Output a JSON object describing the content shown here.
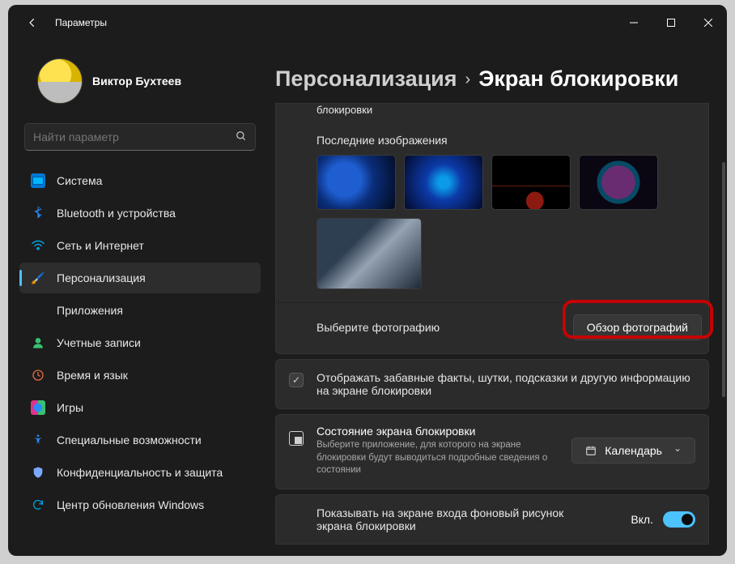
{
  "titlebar": {
    "title": "Параметры"
  },
  "profile": {
    "name": "Виктор Бухтеев",
    "subtitle": ""
  },
  "search": {
    "placeholder": "Найти параметр"
  },
  "sidebar": {
    "items": [
      {
        "label": "Система"
      },
      {
        "label": "Bluetooth и устройства"
      },
      {
        "label": "Сеть и Интернет"
      },
      {
        "label": "Персонализация"
      },
      {
        "label": "Приложения"
      },
      {
        "label": "Учетные записи"
      },
      {
        "label": "Время и язык"
      },
      {
        "label": "Игры"
      },
      {
        "label": "Специальные возможности"
      },
      {
        "label": "Конфиденциальность и защита"
      },
      {
        "label": "Центр обновления Windows"
      }
    ]
  },
  "breadcrumb": {
    "parent": "Персонализация",
    "current": "Экран блокировки"
  },
  "lockscreen": {
    "cutoff_label": "блокировки",
    "recent_label": "Последние изображения",
    "choose_label": "Выберите фотографию",
    "browse_button": "Обзор фотографий",
    "fun_facts": "Отображать забавные факты, шутки, подсказки и другую информацию на экране блокировки",
    "status": {
      "title": "Состояние экрана блокировки",
      "sub": "Выберите приложение, для которого на экране блокировки будут выводиться подробные сведения о состоянии",
      "app": "Календарь"
    },
    "toggle": {
      "label": "Показывать на экране входа фоновый рисунок экрана блокировки",
      "state": "Вкл."
    }
  }
}
